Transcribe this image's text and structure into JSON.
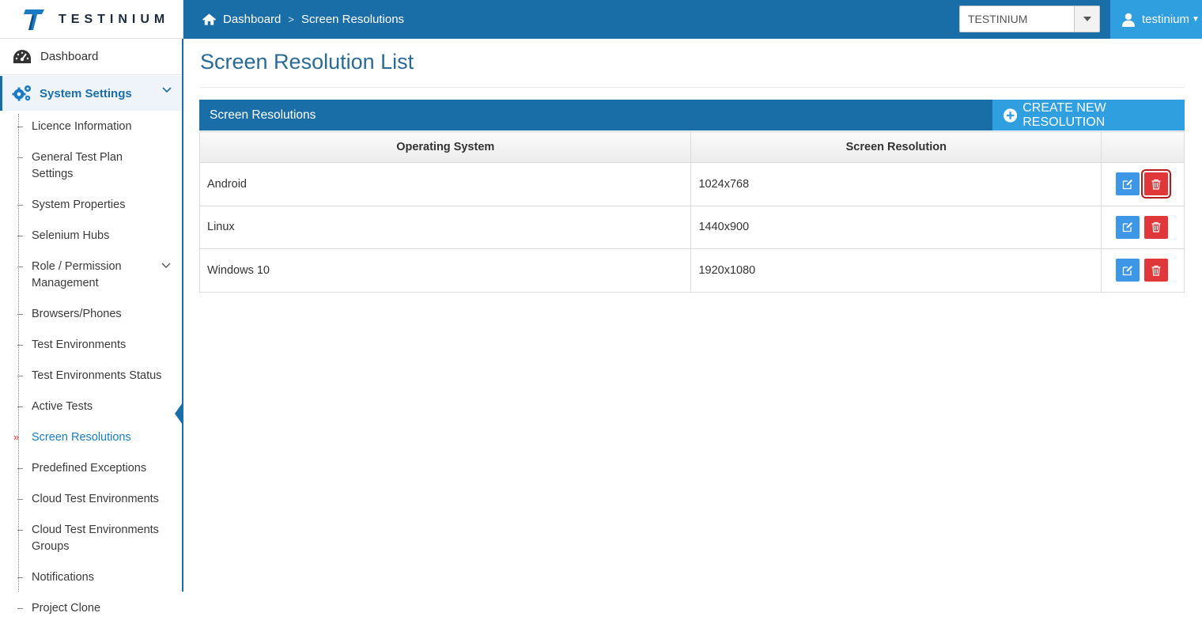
{
  "app": {
    "logo_text": "TESTINIUM"
  },
  "header": {
    "breadcrumb": [
      "Dashboard",
      "Screen Resolutions"
    ],
    "project_selector": "TESTINIUM",
    "user": "testinium"
  },
  "sidebar": {
    "dashboard": "Dashboard",
    "section": "System Settings",
    "items": [
      {
        "label": "Licence Information",
        "active": false
      },
      {
        "label": "General Test Plan Settings",
        "active": false
      },
      {
        "label": "System Properties",
        "active": false
      },
      {
        "label": "Selenium Hubs",
        "active": false
      },
      {
        "label": "Role / Permission Management",
        "active": false,
        "has_children": true
      },
      {
        "label": "Browsers/Phones",
        "active": false
      },
      {
        "label": "Test Environments",
        "active": false
      },
      {
        "label": "Test Environments Status",
        "active": false
      },
      {
        "label": "Active Tests",
        "active": false
      },
      {
        "label": "Screen Resolutions",
        "active": true
      },
      {
        "label": "Predefined Exceptions",
        "active": false
      },
      {
        "label": "Cloud Test Environments",
        "active": false
      },
      {
        "label": "Cloud Test Environments Groups",
        "active": false
      },
      {
        "label": "Notifications",
        "active": false
      },
      {
        "label": "Project Clone",
        "active": false
      }
    ]
  },
  "main": {
    "page_title": "Screen Resolution List",
    "panel_title": "Screen Resolutions",
    "create_button": "CREATE NEW RESOLUTION",
    "table": {
      "columns": [
        "Operating System",
        "Screen Resolution",
        ""
      ],
      "rows": [
        {
          "os": "Android",
          "resolution": "1024x768"
        },
        {
          "os": "Linux",
          "resolution": "1440x900"
        },
        {
          "os": "Windows 10",
          "resolution": "1920x1080"
        }
      ]
    }
  },
  "colors": {
    "primary": "#1a6ea8",
    "accent": "#2f9fe0",
    "edit": "#3d97e6",
    "delete": "#e0383a"
  },
  "icons": [
    "home-icon",
    "user-icon",
    "dashboard-icon",
    "gears-icon",
    "plus-circle-icon",
    "edit-icon",
    "trash-icon"
  ]
}
